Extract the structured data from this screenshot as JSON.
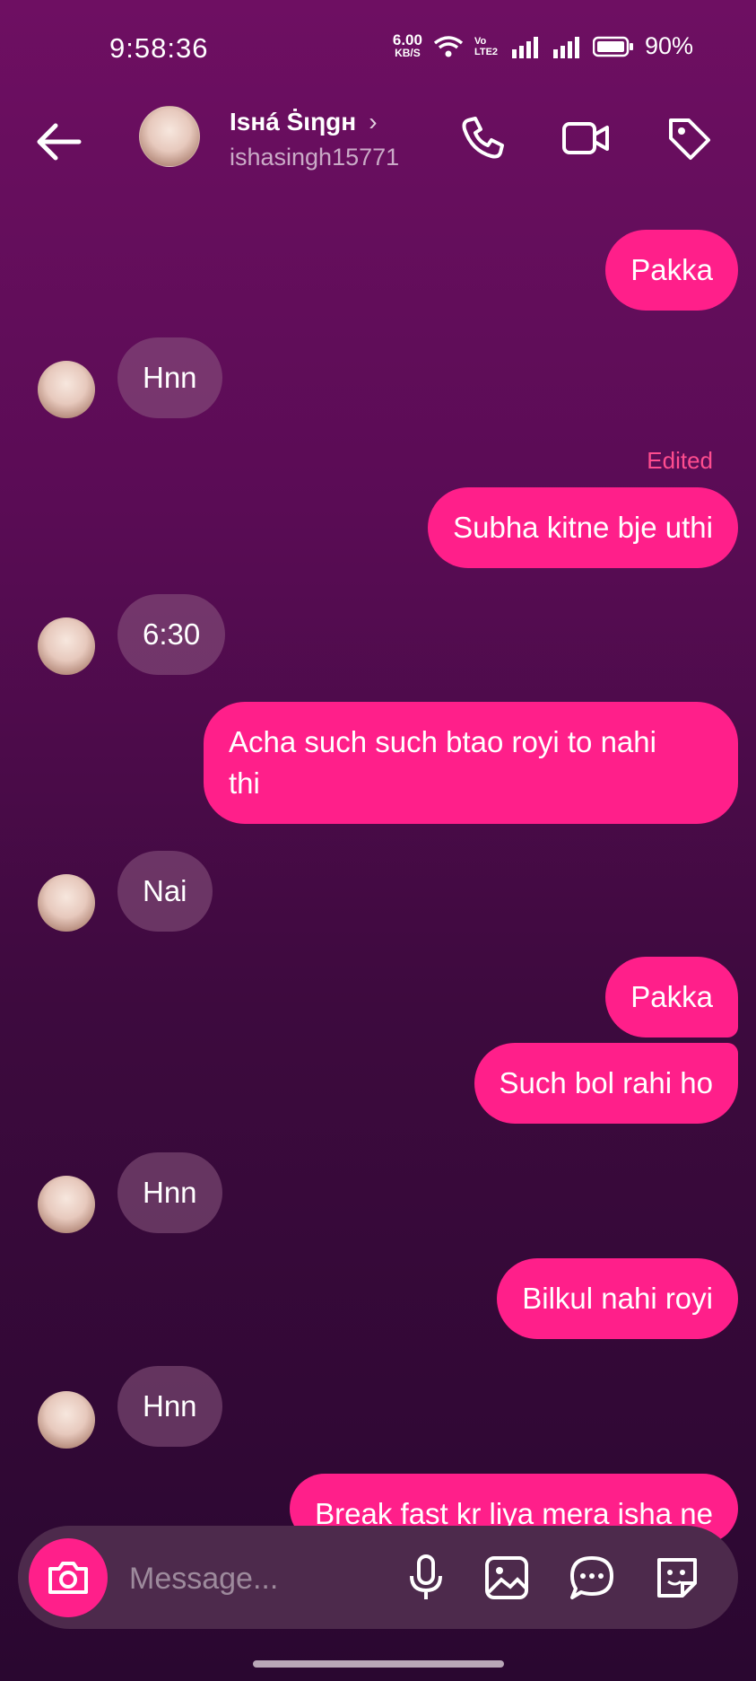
{
  "status": {
    "time": "9:58:36",
    "net_speed_value": "6.00",
    "net_speed_unit": "KB/S",
    "volte": "Vo LTE2",
    "battery": "90%"
  },
  "header": {
    "name": "Ɩѕнá Ṡιηgн",
    "handle": "ishasingh15771"
  },
  "messages": [
    {
      "side": "mine",
      "text": "Pakka"
    },
    {
      "side": "theirs",
      "text": "Hnn"
    },
    {
      "side": "mine",
      "text": "Subha kitne bje uthi",
      "edited": "Edited"
    },
    {
      "side": "theirs",
      "text": "6:30"
    },
    {
      "side": "mine",
      "text_line1": "Acha such such btao royi to nahi",
      "text_line2": "thi"
    },
    {
      "side": "theirs",
      "text": "Nai"
    },
    {
      "side": "mine",
      "text": "Pakka"
    },
    {
      "side": "mine",
      "text": "Such bol rahi ho"
    },
    {
      "side": "theirs",
      "text": "Hnn"
    },
    {
      "side": "mine",
      "text": "Bilkul nahi royi"
    },
    {
      "side": "theirs",
      "text": "Hnn"
    },
    {
      "side": "mine",
      "text": "Break fast kr liya mera isha ne"
    }
  ],
  "composer": {
    "placeholder": "Message..."
  },
  "colors": {
    "accent": "#ff1f8a",
    "theirs_bubble": "#8c5a82",
    "edited": "#ff4d8f"
  },
  "icons": [
    "back-arrow-icon",
    "phone-icon",
    "video-icon",
    "tag-icon",
    "camera-icon",
    "mic-icon",
    "gallery-icon",
    "chat-icon",
    "sticker-icon"
  ]
}
